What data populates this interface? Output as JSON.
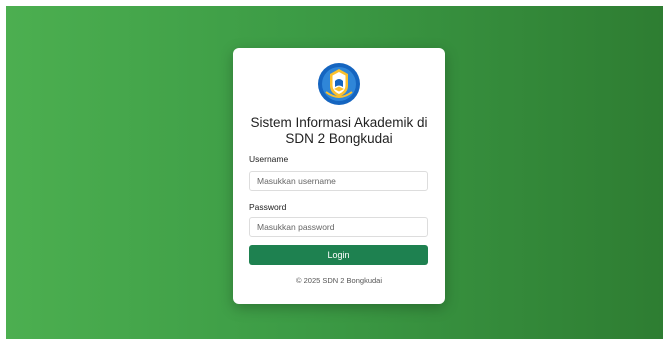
{
  "login": {
    "title_line1": "Sistem Informasi Akademik di",
    "title_line2": "SDN 2 Bongkudai",
    "username_label": "Username",
    "username_placeholder": "Masukkan username",
    "username_value": "",
    "password_label": "Password",
    "password_placeholder": "Masukkan password",
    "password_value": "",
    "login_label": "Login",
    "footer": "© 2025 SDN 2 Bongkudai"
  },
  "colors": {
    "background_start": "#4caf50",
    "background_end": "#2e7d32",
    "button": "#1e8150",
    "logo_blue": "#1565c0",
    "logo_yellow": "#fbc02d"
  },
  "icons": {
    "logo": "school-emblem-icon"
  }
}
